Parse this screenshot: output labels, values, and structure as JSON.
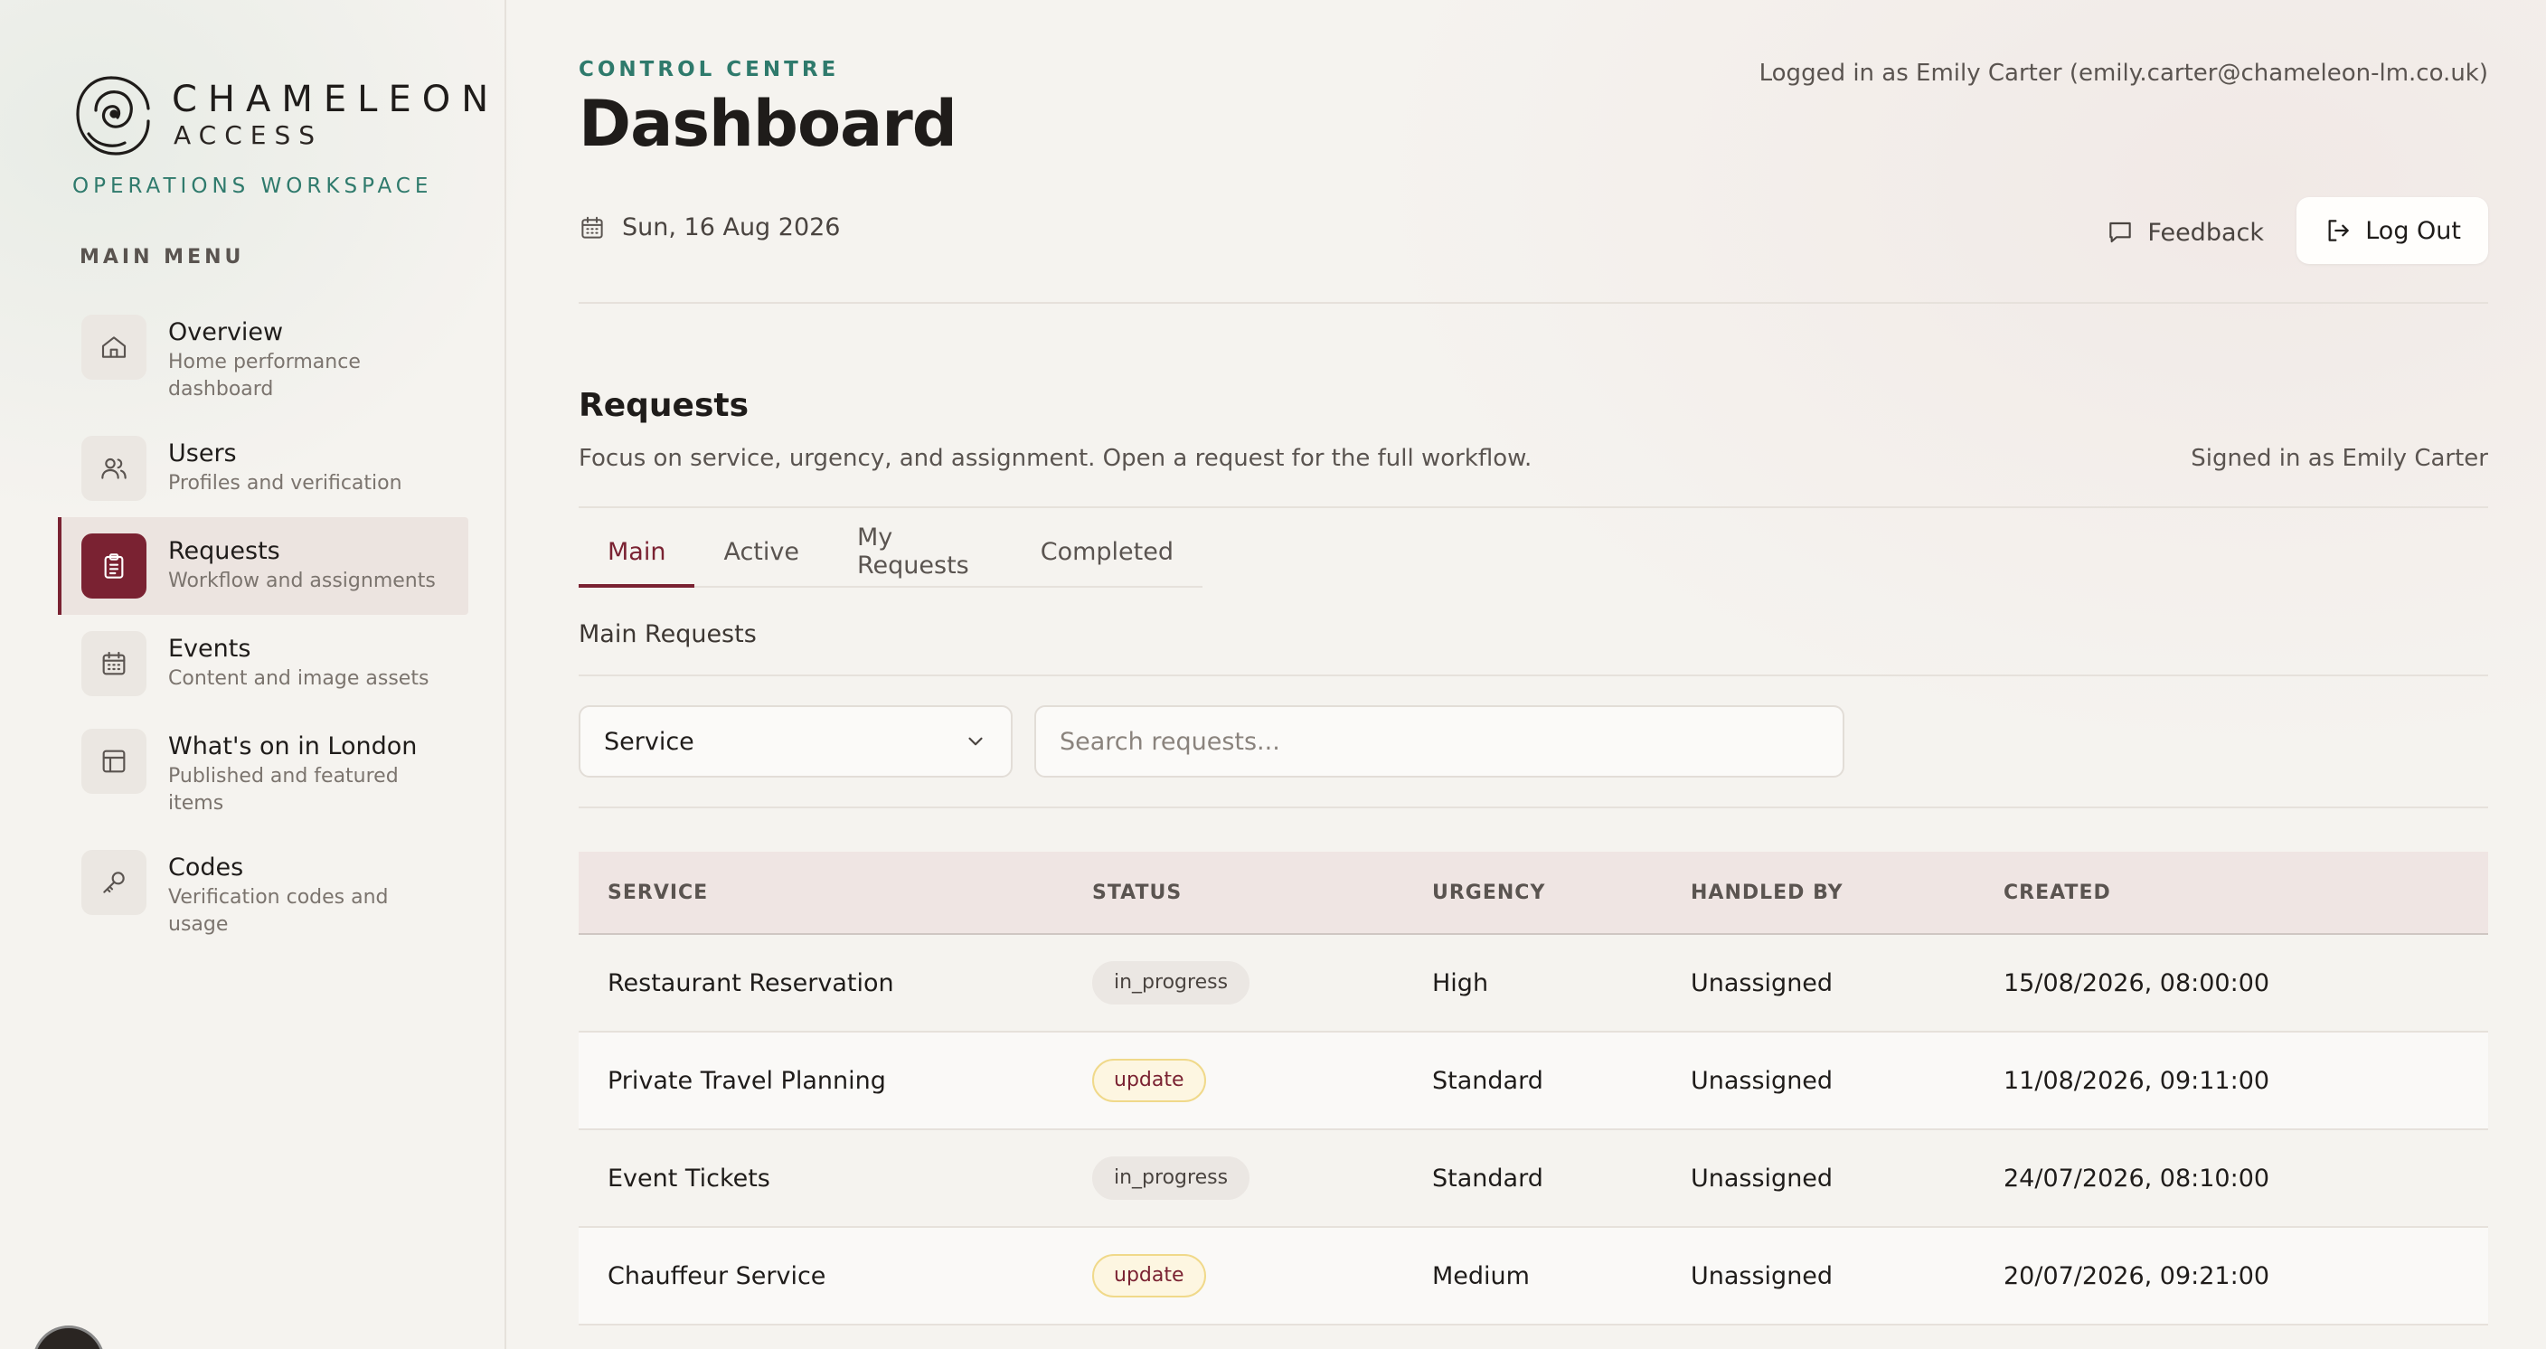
{
  "brand": {
    "name": "CHAMELEON",
    "sub": "ACCESS",
    "workspace": "OPERATIONS WORKSPACE"
  },
  "sidebar": {
    "menu_title": "MAIN MENU",
    "items": [
      {
        "label": "Overview",
        "desc": "Home performance dashboard",
        "icon": "home-icon"
      },
      {
        "label": "Users",
        "desc": "Profiles and verification",
        "icon": "users-icon"
      },
      {
        "label": "Requests",
        "desc": "Workflow and assignments",
        "icon": "clipboard-icon",
        "active": true
      },
      {
        "label": "Events",
        "desc": "Content and image assets",
        "icon": "calendar-icon"
      },
      {
        "label": "What's on in London",
        "desc": "Published and featured items",
        "icon": "layout-icon"
      },
      {
        "label": "Codes",
        "desc": "Verification codes and usage",
        "icon": "key-icon"
      }
    ]
  },
  "header": {
    "eyebrow": "CONTROL CENTRE",
    "title": "Dashboard",
    "logged_in": "Logged in as Emily Carter (emily.carter@chameleon-lm.co.uk)",
    "date": "Sun, 16 Aug 2026",
    "feedback_label": "Feedback",
    "logout_label": "Log Out"
  },
  "requests": {
    "title": "Requests",
    "description": "Focus on service, urgency, and assignment. Open a request for the full workflow.",
    "signed_in": "Signed in as Emily Carter",
    "tabs": [
      "Main",
      "Active",
      "My Requests",
      "Completed"
    ],
    "active_tab": "Main",
    "subheading": "Main Requests",
    "filter_value": "Service",
    "search_placeholder": "Search requests...",
    "columns": [
      "SERVICE",
      "STATUS",
      "URGENCY",
      "HANDLED BY",
      "CREATED"
    ],
    "rows": [
      {
        "service": "Restaurant Reservation",
        "status": "in_progress",
        "urgency": "High",
        "handled_by": "Unassigned",
        "created": "15/08/2026, 08:00:00"
      },
      {
        "service": "Private Travel Planning",
        "status": "update",
        "urgency": "Standard",
        "handled_by": "Unassigned",
        "created": "11/08/2026, 09:11:00"
      },
      {
        "service": "Event Tickets",
        "status": "in_progress",
        "urgency": "Standard",
        "handled_by": "Unassigned",
        "created": "24/07/2026, 08:10:00"
      },
      {
        "service": "Chauffeur Service",
        "status": "update",
        "urgency": "Medium",
        "handled_by": "Unassigned",
        "created": "20/07/2026, 09:21:00"
      }
    ]
  },
  "colors": {
    "accent": "#7a2232",
    "teal": "#2f7a6c",
    "background": "#f5f3ef"
  }
}
